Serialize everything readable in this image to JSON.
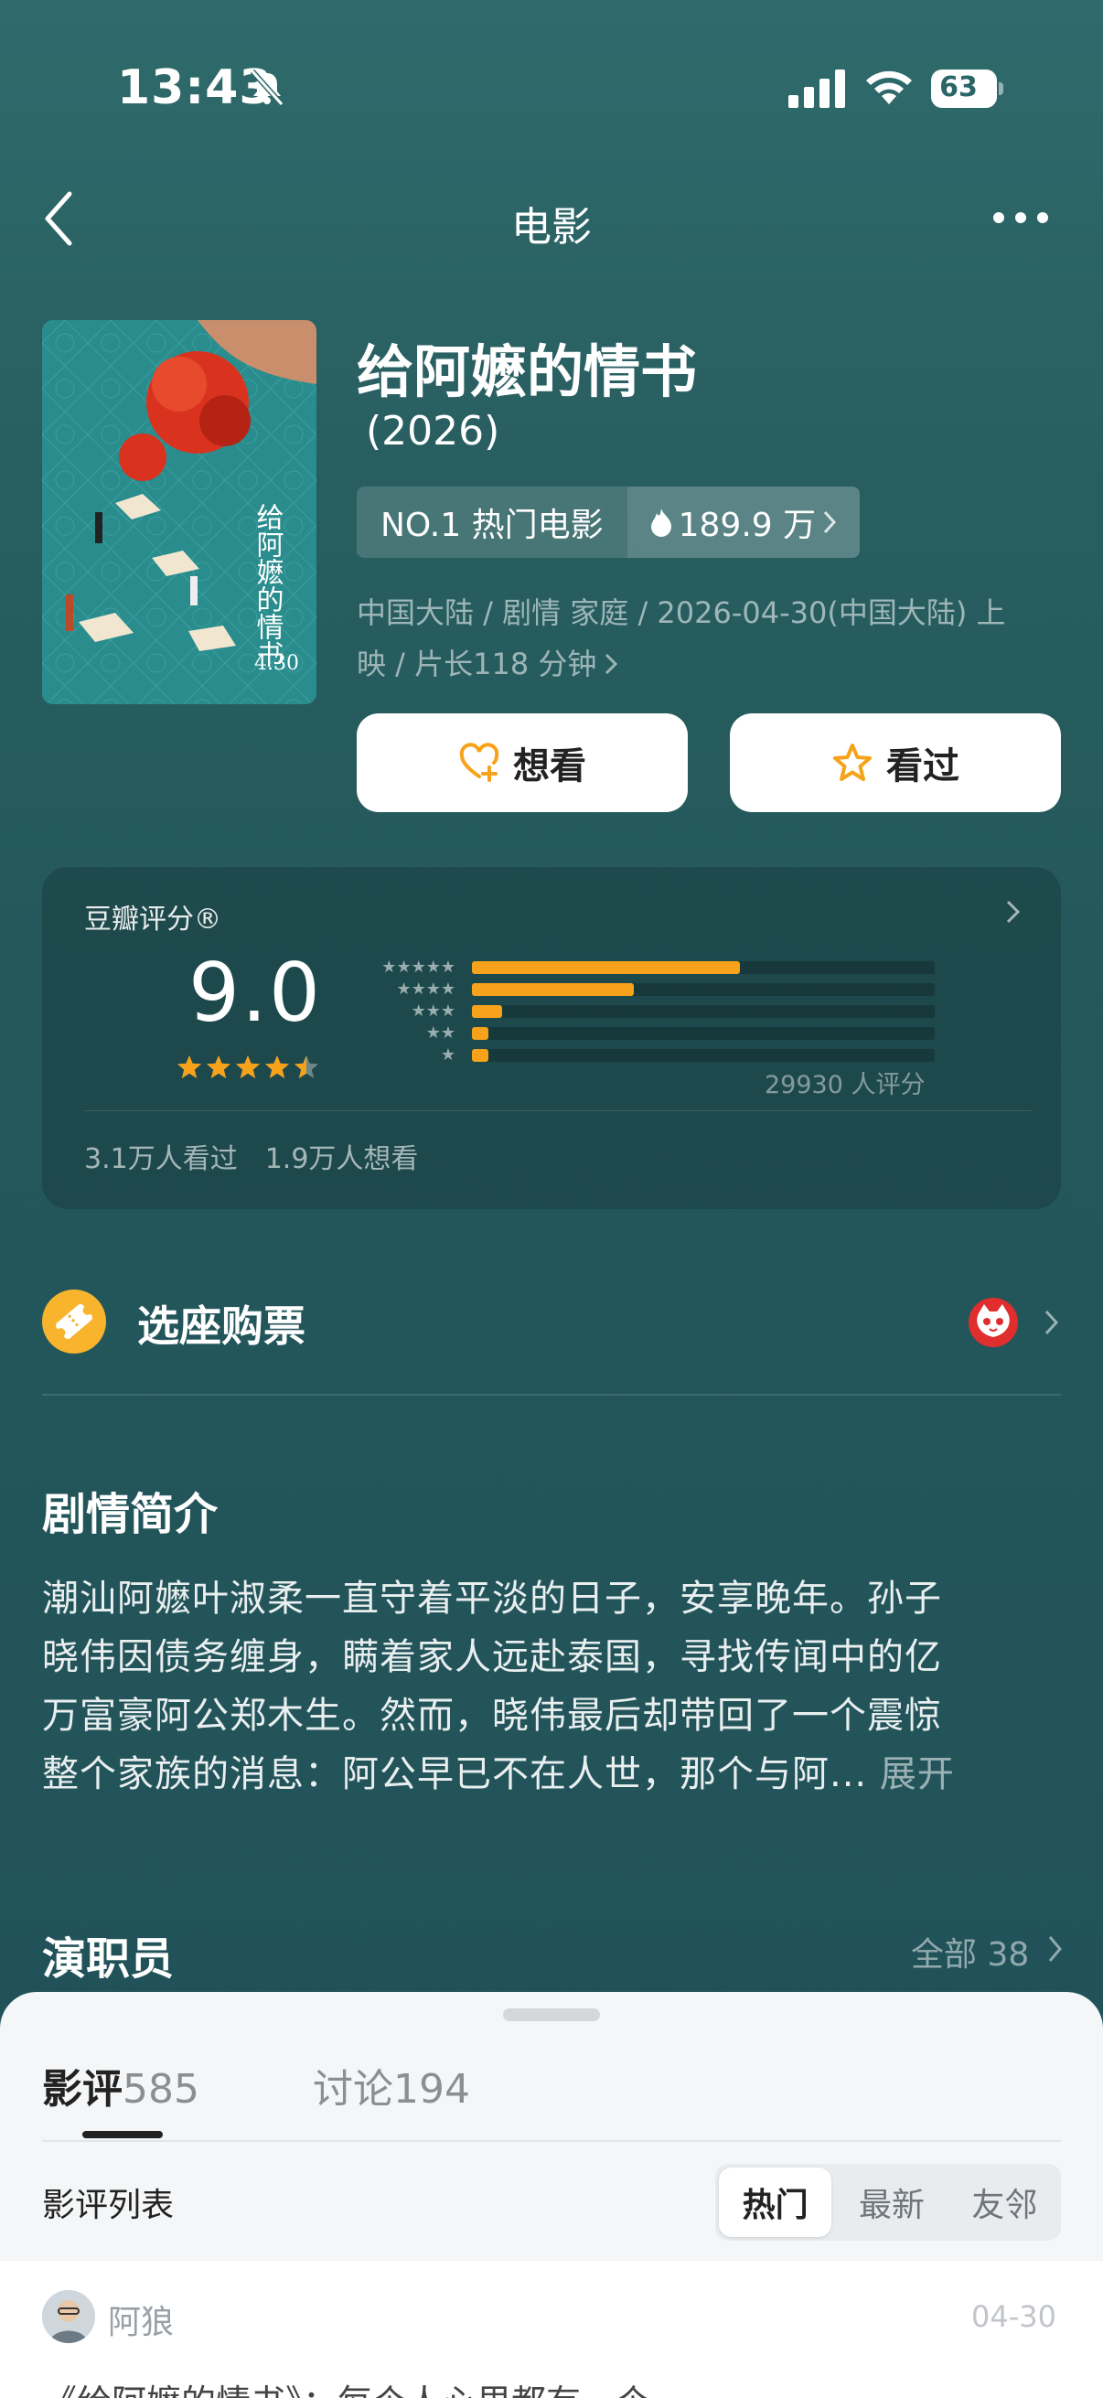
{
  "status_bar": {
    "time": "13:43",
    "battery": "63"
  },
  "nav": {
    "title": "电影"
  },
  "movie": {
    "title": "给阿嬷的情书",
    "year": "(2026)",
    "rank_label": "NO.1 热门电影",
    "heat": "189.9 万",
    "meta_line1": "中国大陆 / 剧情 家庭 / 2026-04-30(中国大陆) 上",
    "meta_line2": "映 / 片长118 分钟"
  },
  "actions": {
    "want_label": "想看",
    "seen_label": "看过"
  },
  "rating": {
    "label": "豆瓣评分®",
    "score": "9.0",
    "star_value": 4.5,
    "distribution": [
      {
        "stars": 5,
        "fraction": 0.58
      },
      {
        "stars": 4,
        "fraction": 0.35
      },
      {
        "stars": 3,
        "fraction": 0.065
      },
      {
        "stars": 2,
        "fraction": 0.035
      },
      {
        "stars": 1,
        "fraction": 0.035
      }
    ],
    "count_text": "29930 人评分",
    "seen_text": "3.1万人看过",
    "want_text": "1.9万人想看"
  },
  "tickets": {
    "label": "选座购票"
  },
  "synopsis": {
    "title": "剧情简介",
    "line1": "潮汕阿嬷叶淑柔一直守着平淡的日子，安享晚年。孙子",
    "line2": "晓伟因债务缠身，瞒着家人远赴泰国，寻找传闻中的亿",
    "line3": "万富豪阿公郑木生。然而，晓伟最后却带回了一个震惊",
    "line4": "整个家族的消息：阿公早已不在人世，那个与阿...",
    "expand": "展开"
  },
  "cast": {
    "title": "演职员",
    "all_label": "全部 38"
  },
  "sheet": {
    "tabs": [
      {
        "label": "影评",
        "count": "585"
      },
      {
        "label": "讨论",
        "count": "194"
      }
    ],
    "list_label": "影评列表",
    "sort_options": [
      "热门",
      "最新",
      "友邻"
    ],
    "review": {
      "author": "阿狼",
      "date": "04-30",
      "text": "《给阿嬷的情书》：每个人心里都有一个"
    }
  },
  "colors": {
    "accent": "#f6a21a",
    "background": "#2b6566",
    "ticket_icon": "#f7b42c"
  }
}
